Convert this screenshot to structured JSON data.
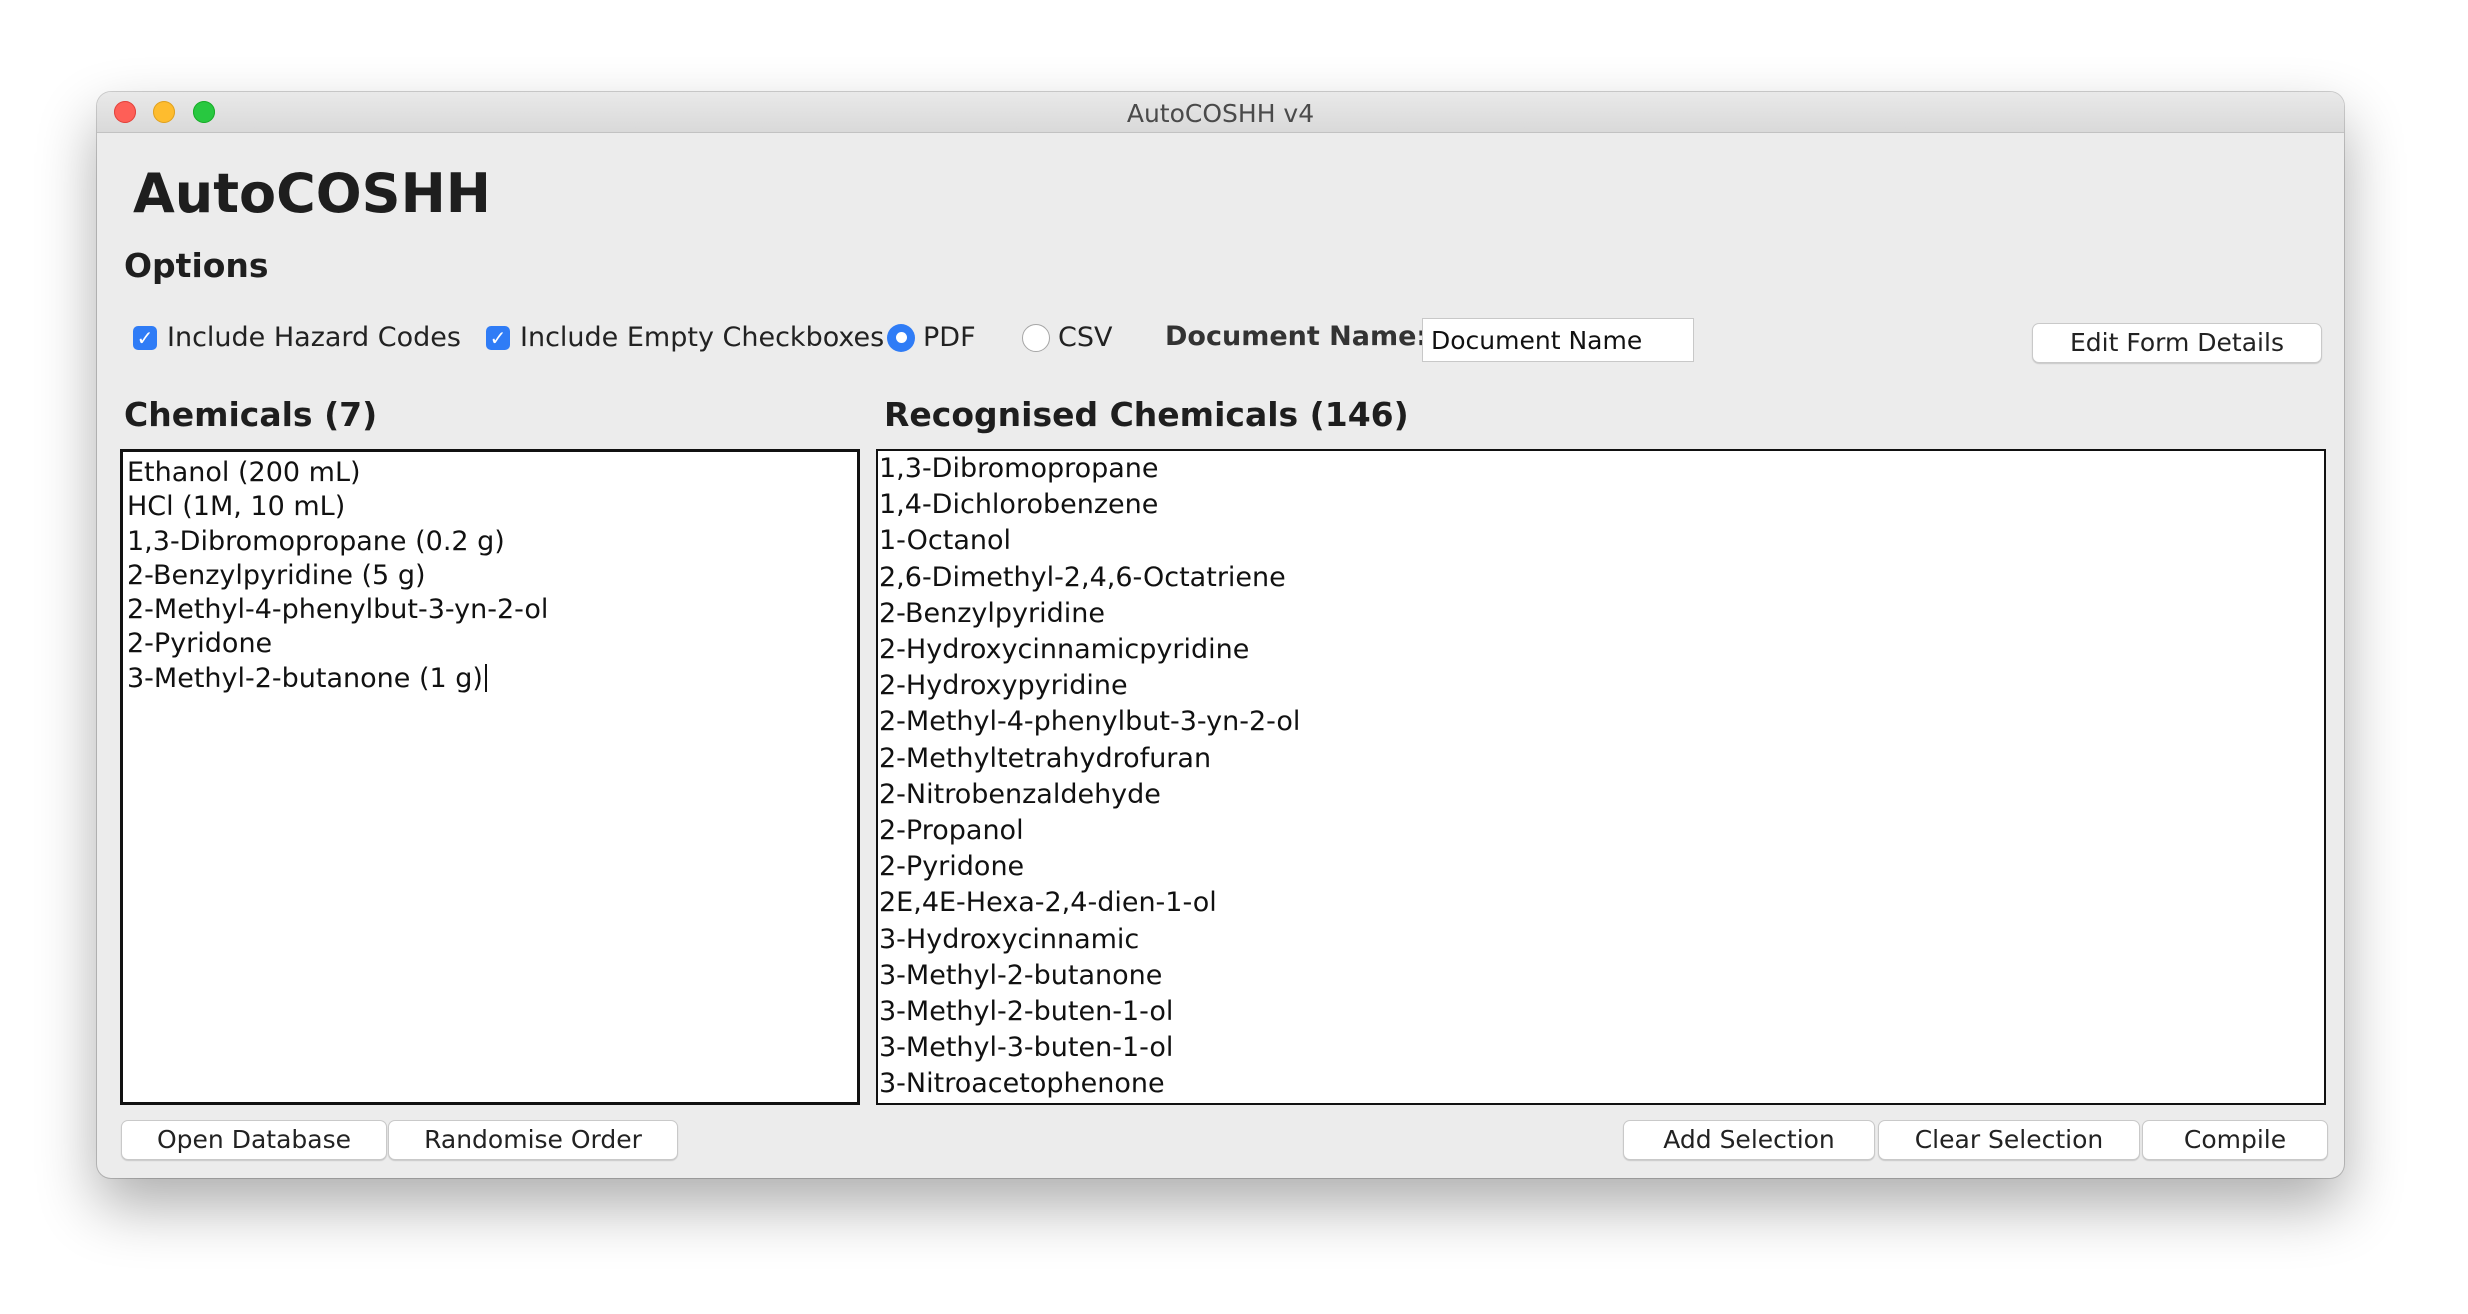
{
  "window": {
    "title": "AutoCOSHH v4"
  },
  "app": {
    "title": "AutoCOSHH"
  },
  "options": {
    "title": "Options",
    "include_hazard_codes": {
      "label": "Include Hazard Codes",
      "checked": true
    },
    "include_empty_checkboxes": {
      "label": "Include Empty Checkboxes",
      "checked": true
    },
    "format_pdf": {
      "label": "PDF",
      "selected": true
    },
    "format_csv": {
      "label": "CSV",
      "selected": false
    },
    "document_name_label": "Document Name:",
    "document_name_value": "Document Name",
    "edit_form_details": "Edit Form Details"
  },
  "chemicals": {
    "title": "Chemicals (7)",
    "lines": [
      "Ethanol (200 mL)",
      "HCl (1M, 10 mL)",
      "1,3-Dibromopropane (0.2 g)",
      "2-Benzylpyridine (5 g)",
      "2-Methyl-4-phenylbut-3-yn-2-ol",
      "2-Pyridone",
      "3-Methyl-2-butanone (1 g)"
    ]
  },
  "recognised": {
    "title": "Recognised Chemicals (146)",
    "items": [
      "1,3-Dibromopropane",
      "1,4-Dichlorobenzene",
      "1-Octanol",
      "2,6-Dimethyl-2,4,6-Octatriene",
      "2-Benzylpyridine",
      "2-Hydroxycinnamicpyridine",
      "2-Hydroxypyridine",
      "2-Methyl-4-phenylbut-3-yn-2-ol",
      "2-Methyltetrahydrofuran",
      "2-Nitrobenzaldehyde",
      "2-Propanol",
      "2-Pyridone",
      "2E,4E-Hexa-2,4-dien-1-ol",
      "3-Hydroxycinnamic",
      "3-Methyl-2-butanone",
      "3-Methyl-2-buten-1-ol",
      "3-Methyl-3-buten-1-ol",
      "3-Nitroacetophenone"
    ]
  },
  "buttons": {
    "open_database": "Open Database",
    "randomise_order": "Randomise Order",
    "add_selection": "Add Selection",
    "clear_selection": "Clear Selection",
    "compile": "Compile"
  },
  "colors": {
    "accent": "#2f7cf6",
    "window_bg": "#ececec"
  }
}
